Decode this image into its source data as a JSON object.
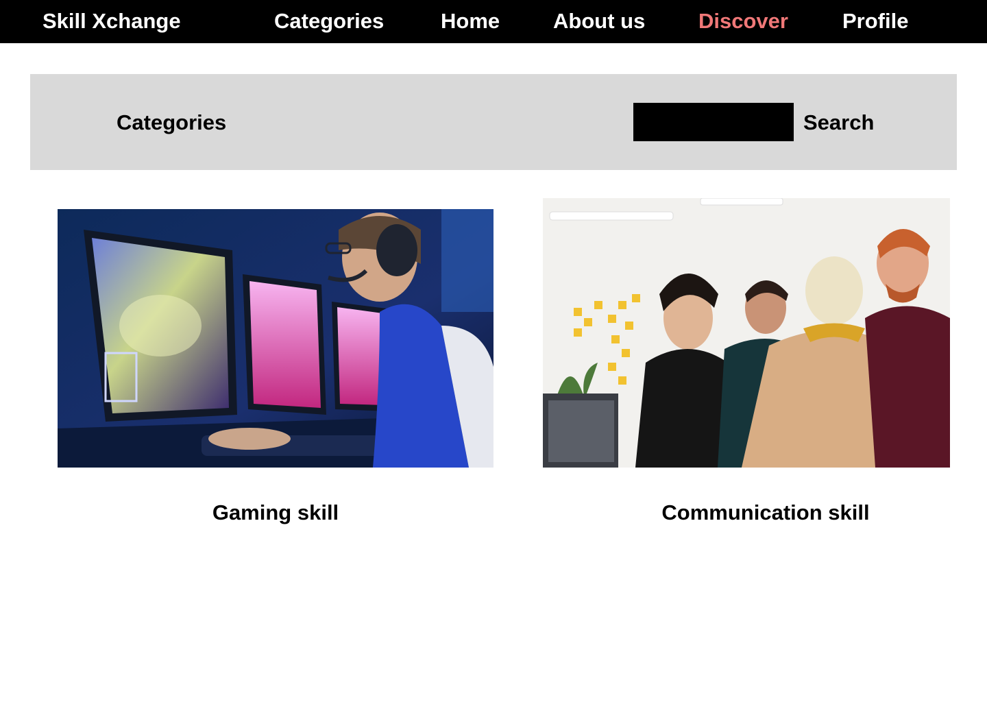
{
  "nav": {
    "brand": "Skill Xchange",
    "items": [
      {
        "label": "Categories"
      },
      {
        "label": "Home"
      },
      {
        "label": "About us"
      },
      {
        "label": "Discover",
        "active": true
      },
      {
        "label": "Profile"
      }
    ],
    "active_color": "#f07878"
  },
  "banner": {
    "title": "Categories",
    "search": {
      "value": "",
      "placeholder": "",
      "button_label": "Search"
    }
  },
  "cards": [
    {
      "title": "Gaming skill",
      "image": "gaming-photo"
    },
    {
      "title": "Communication skill",
      "image": "team-meeting-photo"
    }
  ],
  "colors": {
    "nav_background": "#000000",
    "banner_background": "#d9d9d9",
    "search_field": "#000000"
  }
}
